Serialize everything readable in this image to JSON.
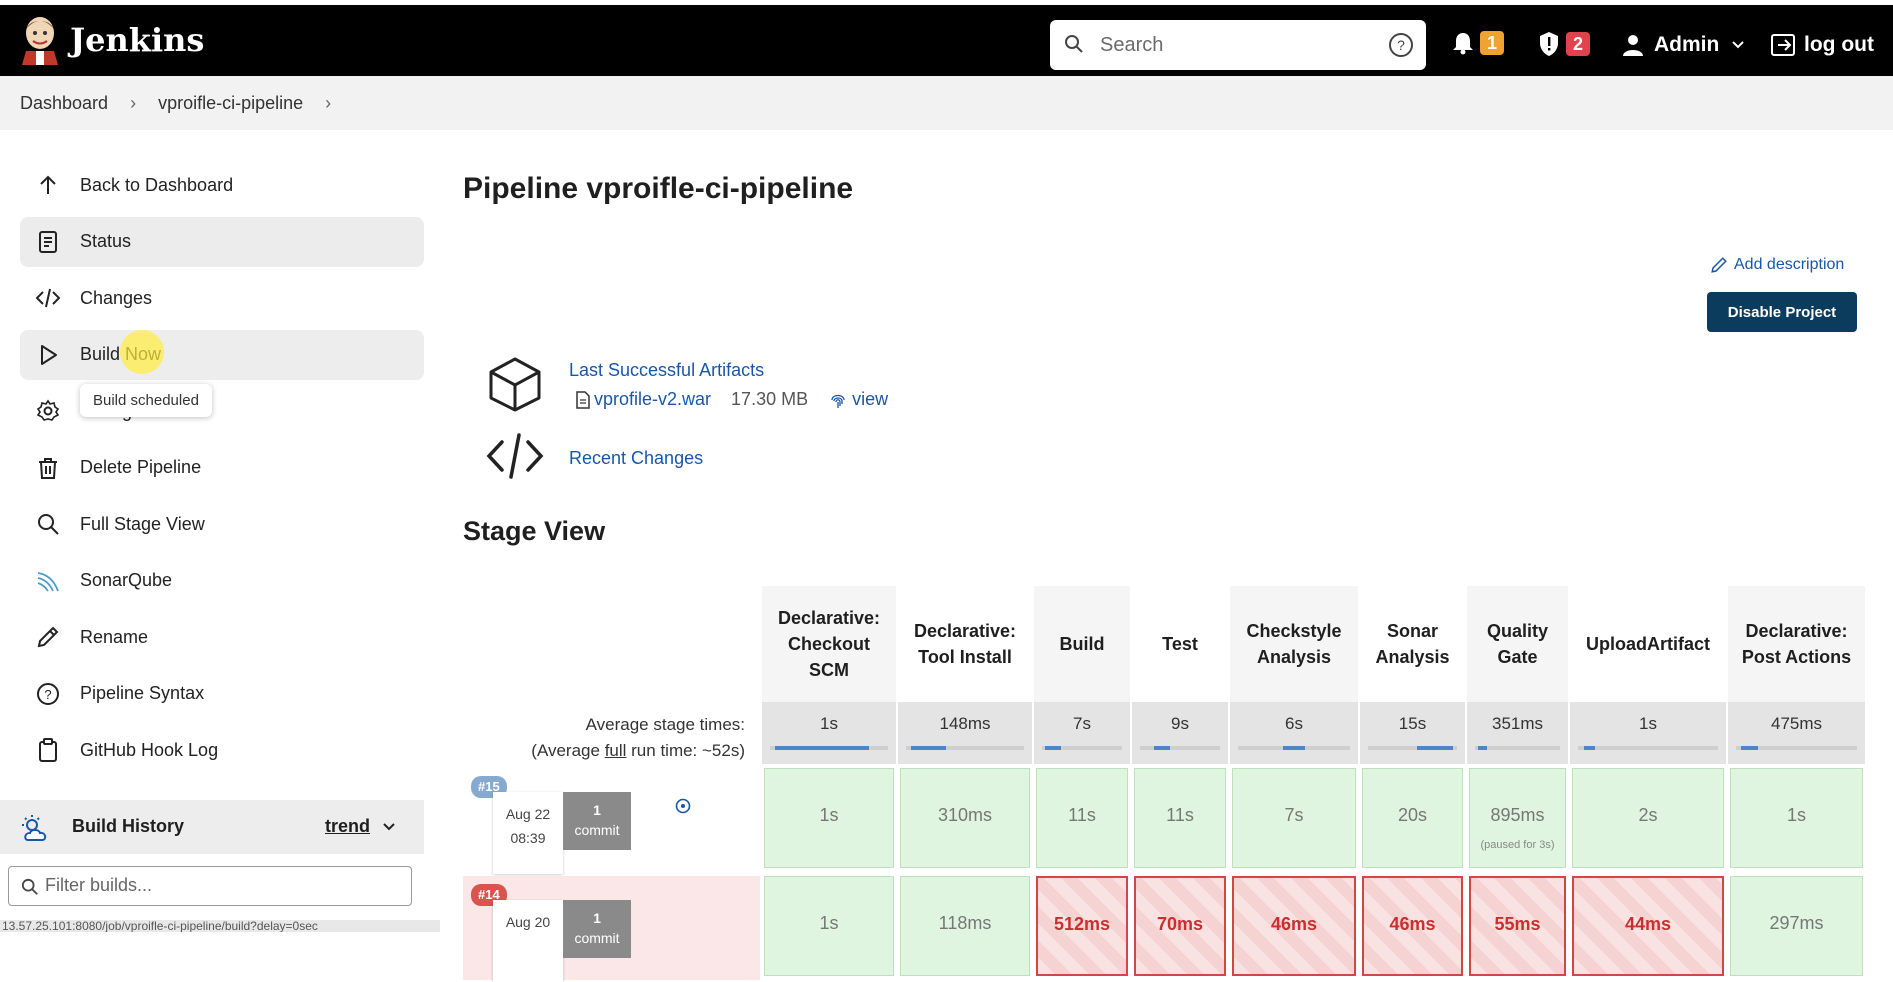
{
  "app": {
    "title": "Jenkins"
  },
  "header": {
    "search_placeholder": "Search",
    "notifications_count": "1",
    "security_count": "2",
    "user_name": "Admin",
    "logout_label": "log out"
  },
  "breadcrumb": {
    "items": [
      "Dashboard",
      "vproifle-ci-pipeline"
    ]
  },
  "sidebar": {
    "items": [
      {
        "label": "Back to Dashboard",
        "icon": "arrow-up-icon"
      },
      {
        "label": "Status",
        "icon": "document-icon"
      },
      {
        "label": "Changes",
        "icon": "code-icon"
      },
      {
        "label": "Build Now",
        "icon": "play-icon"
      },
      {
        "label": "Configure",
        "icon": "gear-icon"
      },
      {
        "label": "Delete Pipeline",
        "icon": "trash-icon"
      },
      {
        "label": "Full Stage View",
        "icon": "search-icon"
      },
      {
        "label": "SonarQube",
        "icon": "sonarqube-icon"
      },
      {
        "label": "Rename",
        "icon": "pencil-icon"
      },
      {
        "label": "Pipeline Syntax",
        "icon": "help-icon"
      },
      {
        "label": "GitHub Hook Log",
        "icon": "clipboard-icon"
      }
    ],
    "tooltip": "Build scheduled",
    "build_history": {
      "title": "Build History",
      "trend_label": "trend",
      "filter_placeholder": "Filter builds..."
    },
    "status_url": "13.57.25.101:8080/job/vproifle-ci-pipeline/build?delay=0sec"
  },
  "main": {
    "title": "Pipeline vproifle-ci-pipeline",
    "add_description": "Add description",
    "disable_button": "Disable Project",
    "artifacts": {
      "title": "Last Successful Artifacts",
      "file": "vprofile-v2.war",
      "size": "17.30 MB",
      "view": "view"
    },
    "recent_changes": "Recent Changes",
    "stage_view_title": "Stage View",
    "avg_label_1": "Average stage times:",
    "avg_label_2a": "(Average ",
    "avg_label_2b": "full",
    "avg_label_2c": " run time: ~52s)"
  },
  "stages": [
    {
      "name": "Declarative: Checkout SCM",
      "avg": "1s"
    },
    {
      "name": "Declarative: Tool Install",
      "avg": "148ms"
    },
    {
      "name": "Build",
      "avg": "7s"
    },
    {
      "name": "Test",
      "avg": "9s"
    },
    {
      "name": "Checkstyle Analysis",
      "avg": "6s"
    },
    {
      "name": "Sonar Analysis",
      "avg": "15s"
    },
    {
      "name": "Quality Gate",
      "avg": "351ms"
    },
    {
      "name": "UploadArtifact",
      "avg": "1s"
    },
    {
      "name": "Declarative: Post Actions",
      "avg": "475ms"
    }
  ],
  "runs": [
    {
      "id": "#15",
      "date": "Aug 22",
      "time": "08:39",
      "commits": "1",
      "commit_label": "commit",
      "times": [
        "1s",
        "310ms",
        "11s",
        "11s",
        "7s",
        "20s",
        "895ms",
        "2s",
        "1s"
      ],
      "failed": [
        false,
        false,
        false,
        false,
        false,
        false,
        false,
        false,
        false
      ],
      "quality_note": "(paused for 3s)"
    },
    {
      "id": "#14",
      "date": "Aug 20",
      "time": "",
      "commits": "1",
      "commit_label": "commit",
      "times": [
        "1s",
        "118ms",
        "512ms",
        "70ms",
        "46ms",
        "46ms",
        "55ms",
        "44ms",
        "297ms"
      ],
      "failed": [
        false,
        false,
        true,
        true,
        true,
        true,
        true,
        true,
        false
      ]
    }
  ]
}
